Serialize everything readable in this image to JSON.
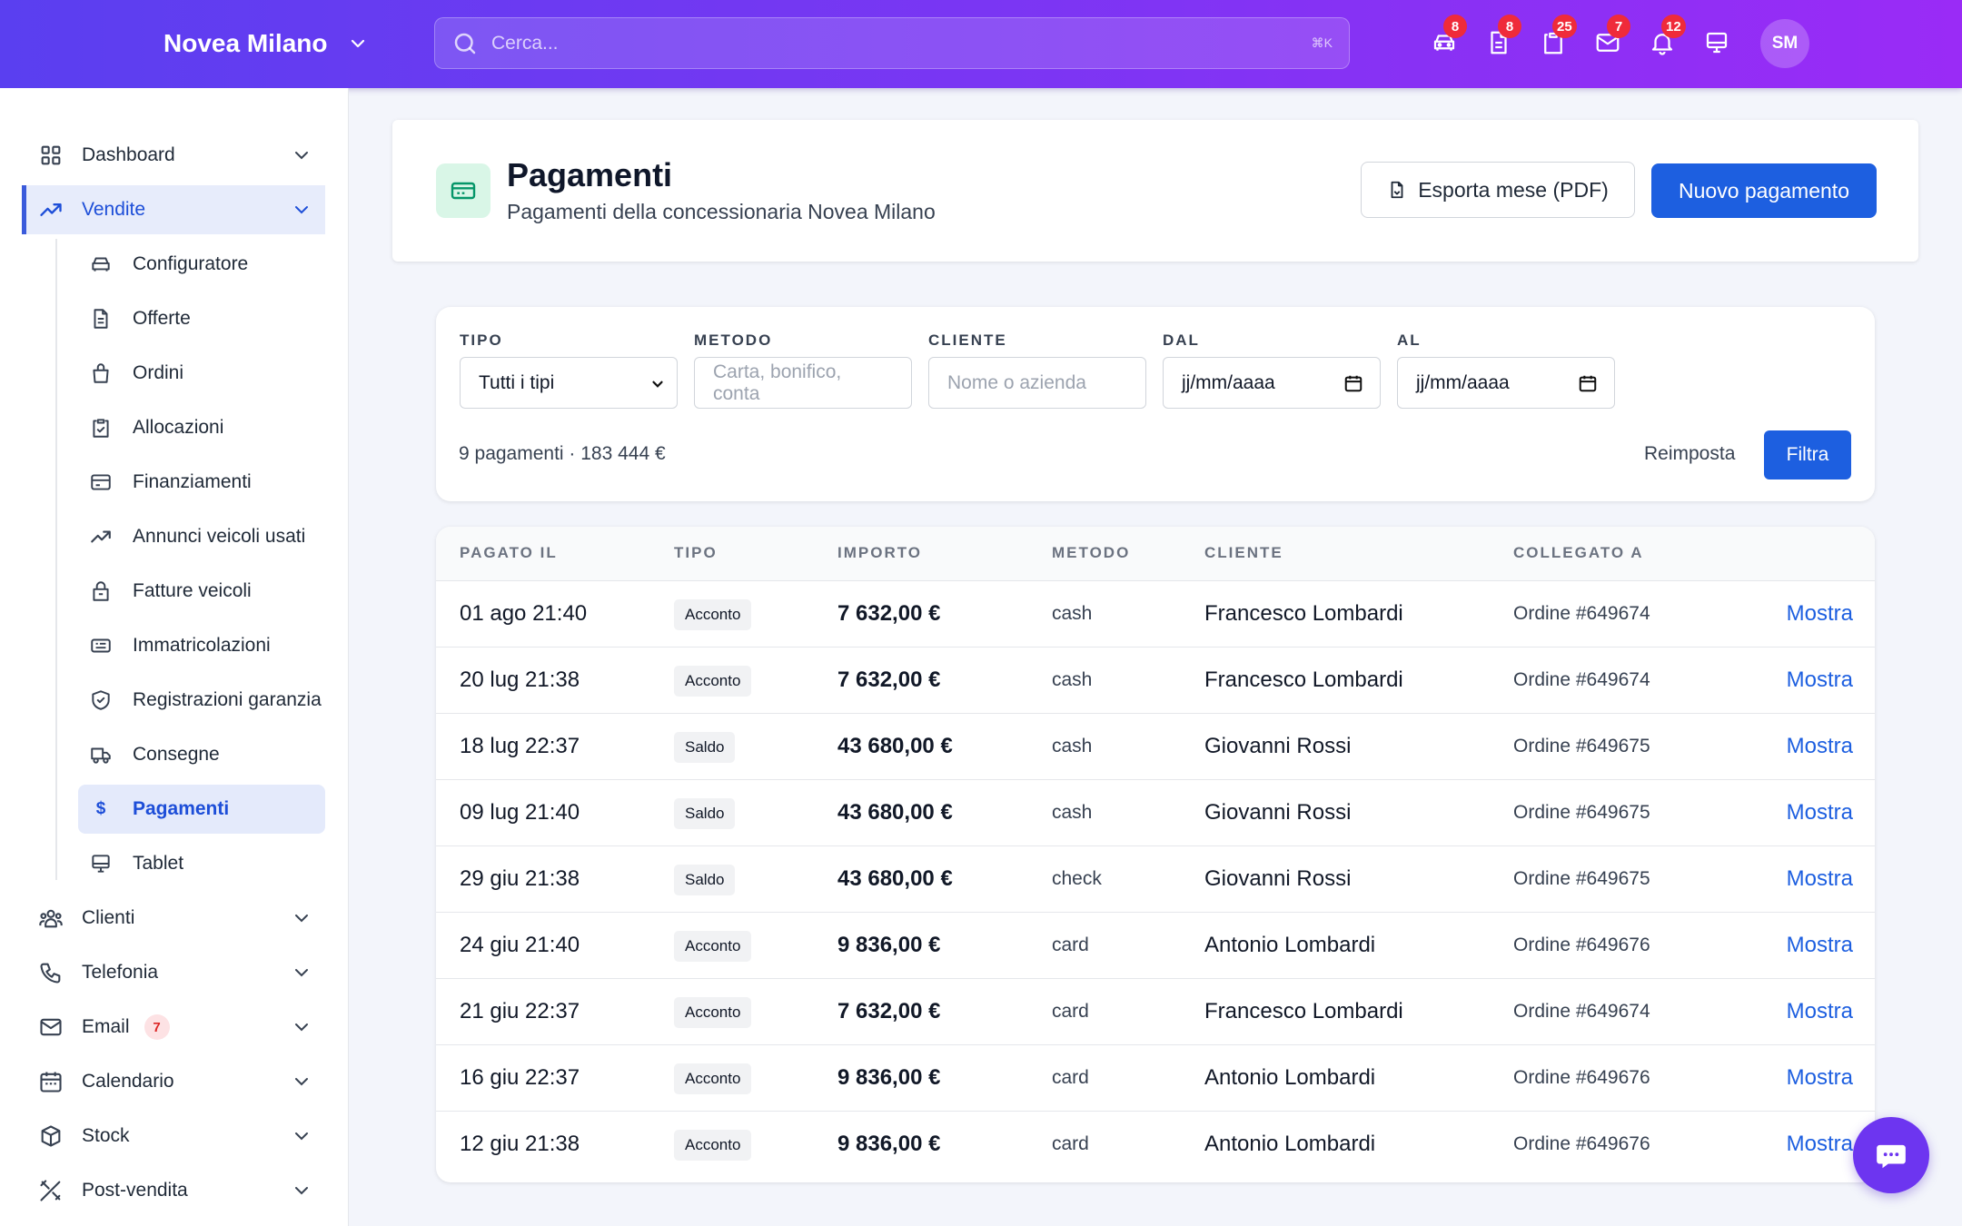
{
  "topbar": {
    "brand": "Novea Milano",
    "search_placeholder": "Cerca...",
    "search_shortcut": "⌘K",
    "icons": [
      {
        "name": "car-icon",
        "badge": "8"
      },
      {
        "name": "document-icon",
        "badge": "8"
      },
      {
        "name": "clipboard-icon",
        "badge": "25"
      },
      {
        "name": "mail-icon",
        "badge": "7"
      },
      {
        "name": "bell-icon",
        "badge": "12"
      },
      {
        "name": "monitor-icon",
        "badge": ""
      }
    ],
    "avatar": "SM"
  },
  "sidebar": {
    "items": [
      {
        "label": "Dashboard",
        "icon": "grid-icon"
      },
      {
        "label": "Vendite",
        "icon": "trending-up-icon",
        "active": true
      },
      {
        "label": "Clienti",
        "icon": "users-icon"
      },
      {
        "label": "Telefonia",
        "icon": "phone-icon"
      },
      {
        "label": "Email",
        "icon": "mail-icon",
        "badge": "7"
      },
      {
        "label": "Calendario",
        "icon": "calendar-icon"
      },
      {
        "label": "Stock",
        "icon": "box-icon"
      },
      {
        "label": "Post-vendita",
        "icon": "tools-icon"
      }
    ],
    "sub_items": [
      {
        "label": "Configuratore",
        "icon": "car-icon"
      },
      {
        "label": "Offerte",
        "icon": "document-icon"
      },
      {
        "label": "Ordini",
        "icon": "bag-icon"
      },
      {
        "label": "Allocazioni",
        "icon": "clipboard-check-icon"
      },
      {
        "label": "Finanziamenti",
        "icon": "credit-card-icon"
      },
      {
        "label": "Annunci veicoli usati",
        "icon": "trending-up-icon"
      },
      {
        "label": "Fatture veicoli",
        "icon": "lock-bag-icon"
      },
      {
        "label": "Immatricolazioni",
        "icon": "id-card-icon"
      },
      {
        "label": "Registrazioni garanzia",
        "icon": "shield-icon"
      },
      {
        "label": "Consegne",
        "icon": "truck-icon"
      },
      {
        "label": "Pagamenti",
        "icon": "dollar-icon",
        "glyph": "$",
        "active": true
      },
      {
        "label": "Tablet",
        "icon": "monitor-icon"
      }
    ]
  },
  "header": {
    "title": "Pagamenti",
    "subtitle": "Pagamenti della concessionaria Novea Milano",
    "export_label": "Esporta mese (PDF)",
    "new_label": "Nuovo pagamento"
  },
  "filters": {
    "tipo_label": "TIPO",
    "tipo_value": "Tutti i tipi",
    "metodo_label": "METODO",
    "metodo_placeholder": "Carta, bonifico, conta",
    "cliente_label": "CLIENTE",
    "cliente_placeholder": "Nome o azienda",
    "dal_label": "DAL",
    "dal_value": "jj/mm/aaaa",
    "al_label": "AL",
    "al_value": "jj/mm/aaaa",
    "summary": "9 pagamenti · 183 444 €",
    "reset_label": "Reimposta",
    "filter_label": "Filtra"
  },
  "table": {
    "columns": [
      "PAGATO IL",
      "TIPO",
      "IMPORTO",
      "METODO",
      "CLIENTE",
      "COLLEGATO A"
    ],
    "action_label": "Mostra",
    "rows": [
      {
        "date": "01 ago 21:40",
        "type": "Acconto",
        "amount": "7 632,00 €",
        "method": "cash",
        "client": "Francesco Lombardi",
        "link": "Ordine #649674"
      },
      {
        "date": "20 lug 21:38",
        "type": "Acconto",
        "amount": "7 632,00 €",
        "method": "cash",
        "client": "Francesco Lombardi",
        "link": "Ordine #649674"
      },
      {
        "date": "18 lug 22:37",
        "type": "Saldo",
        "amount": "43 680,00 €",
        "method": "cash",
        "client": "Giovanni Rossi",
        "link": "Ordine #649675"
      },
      {
        "date": "09 lug 21:40",
        "type": "Saldo",
        "amount": "43 680,00 €",
        "method": "cash",
        "client": "Giovanni Rossi",
        "link": "Ordine #649675"
      },
      {
        "date": "29 giu 21:38",
        "type": "Saldo",
        "amount": "43 680,00 €",
        "method": "check",
        "client": "Giovanni Rossi",
        "link": "Ordine #649675"
      },
      {
        "date": "24 giu 21:40",
        "type": "Acconto",
        "amount": "9 836,00 €",
        "method": "card",
        "client": "Antonio Lombardi",
        "link": "Ordine #649676"
      },
      {
        "date": "21 giu 22:37",
        "type": "Acconto",
        "amount": "7 632,00 €",
        "method": "card",
        "client": "Francesco Lombardi",
        "link": "Ordine #649674"
      },
      {
        "date": "16 giu 22:37",
        "type": "Acconto",
        "amount": "9 836,00 €",
        "method": "card",
        "client": "Antonio Lombardi",
        "link": "Ordine #649676"
      },
      {
        "date": "12 giu 21:38",
        "type": "Acconto",
        "amount": "9 836,00 €",
        "method": "card",
        "client": "Antonio Lombardi",
        "link": "Ordine #649676"
      }
    ]
  },
  "colors": {
    "accent": "#1d5fe0",
    "topbar_start": "#5a3ff0",
    "topbar_end": "#9a2bf6",
    "badge": "#ef2b3a"
  }
}
